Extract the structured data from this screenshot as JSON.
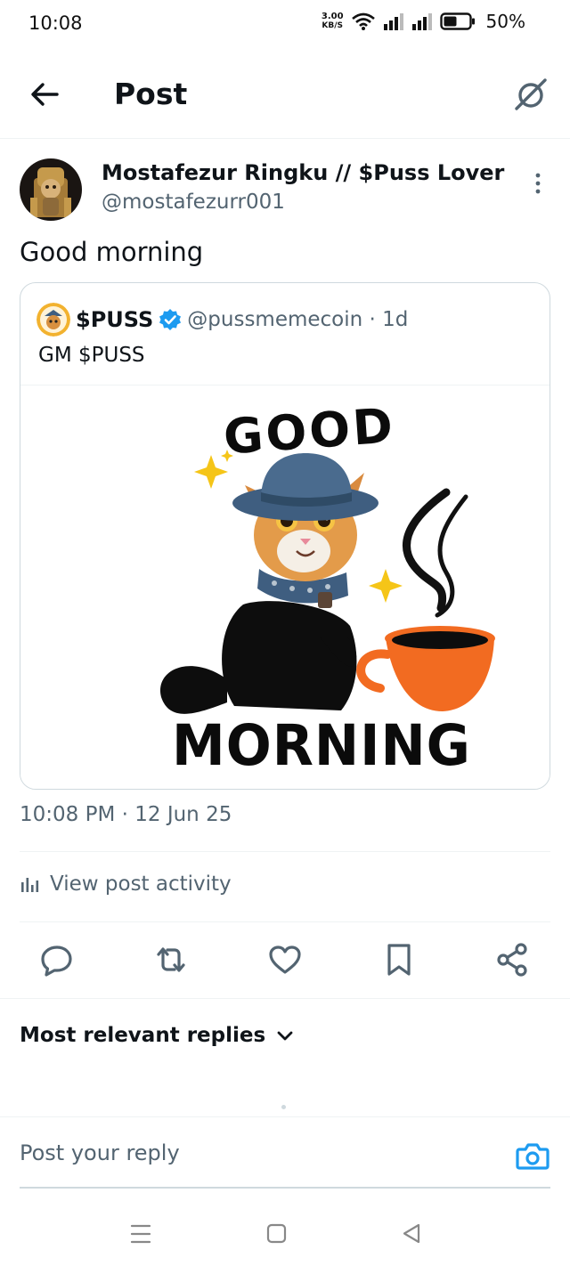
{
  "status_bar": {
    "time": "10:08",
    "net_speed_value": "3.00",
    "net_speed_unit": "KB/S",
    "battery_percent": "50%"
  },
  "header": {
    "title": "Post",
    "back_icon": "arrow-left-icon",
    "grok_icon": "grok-icon"
  },
  "post": {
    "author_name": "Mostafezur Ringku // $Puss Lover",
    "author_handle": "@mostafezurr001",
    "text": "Good morning",
    "timestamp": "10:08 PM · 12 Jun 25",
    "activity_label": "View post activity"
  },
  "quoted_post": {
    "name": "$PUSS",
    "handle_time": "@pussmemecoin · 1d",
    "text": "GM $PUSS",
    "media_word_top": "GOOD",
    "media_word_bottom": "MORNING"
  },
  "actions": [
    "reply-icon",
    "repost-icon",
    "like-icon",
    "bookmark-icon",
    "share-icon"
  ],
  "replies": {
    "sort_label": "Most relevant replies"
  },
  "composer": {
    "placeholder": "Post your reply"
  },
  "colors": {
    "accent": "#1d9bf0",
    "secondary_text": "#536471",
    "border": "#cfd9de",
    "coffee_cup": "#f26b21",
    "hat": "#3f5e80"
  }
}
